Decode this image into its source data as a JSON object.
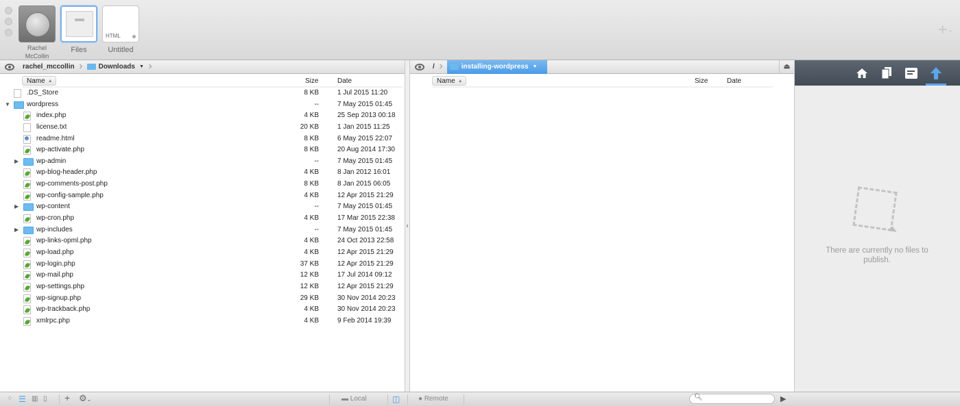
{
  "toolbar": {
    "sites": [
      {
        "label": "Rachel McCollin"
      },
      {
        "label": "Files"
      },
      {
        "label": "Untitled",
        "thumb_tag": "HTML"
      }
    ],
    "add_glyph": "+",
    "add_chevron": "⌄"
  },
  "local": {
    "crumbs": [
      "rachel_mccollin",
      "Downloads"
    ],
    "columns": {
      "name": "Name",
      "size": "Size",
      "date": "Date"
    },
    "files": [
      {
        "name": ".DS_Store",
        "size": "8 KB",
        "date": "1 Jul 2015 11:20",
        "type": "file",
        "level": 0
      },
      {
        "name": "wordpress",
        "size": "--",
        "date": "7 May 2015 01:45",
        "type": "folder",
        "level": 0,
        "expanded": true
      },
      {
        "name": "index.php",
        "size": "4 KB",
        "date": "25 Sep 2013 00:18",
        "type": "php",
        "level": 1
      },
      {
        "name": "license.txt",
        "size": "20 KB",
        "date": "1 Jan 2015 11:25",
        "type": "file",
        "level": 1
      },
      {
        "name": "readme.html",
        "size": "8 KB",
        "date": "6 May 2015 22:07",
        "type": "html",
        "level": 1
      },
      {
        "name": "wp-activate.php",
        "size": "8 KB",
        "date": "20 Aug 2014 17:30",
        "type": "php",
        "level": 1
      },
      {
        "name": "wp-admin",
        "size": "--",
        "date": "7 May 2015 01:45",
        "type": "folder",
        "level": 1,
        "expanded": false
      },
      {
        "name": "wp-blog-header.php",
        "size": "4 KB",
        "date": "8 Jan 2012 16:01",
        "type": "php",
        "level": 1
      },
      {
        "name": "wp-comments-post.php",
        "size": "8 KB",
        "date": "8 Jan 2015 06:05",
        "type": "php",
        "level": 1
      },
      {
        "name": "wp-config-sample.php",
        "size": "4 KB",
        "date": "12 Apr 2015 21:29",
        "type": "php",
        "level": 1
      },
      {
        "name": "wp-content",
        "size": "--",
        "date": "7 May 2015 01:45",
        "type": "folder",
        "level": 1,
        "expanded": false
      },
      {
        "name": "wp-cron.php",
        "size": "4 KB",
        "date": "17 Mar 2015 22:38",
        "type": "php",
        "level": 1
      },
      {
        "name": "wp-includes",
        "size": "--",
        "date": "7 May 2015 01:45",
        "type": "folder",
        "level": 1,
        "expanded": false
      },
      {
        "name": "wp-links-opml.php",
        "size": "4 KB",
        "date": "24 Oct 2013 22:58",
        "type": "php",
        "level": 1
      },
      {
        "name": "wp-load.php",
        "size": "4 KB",
        "date": "12 Apr 2015 21:29",
        "type": "php",
        "level": 1
      },
      {
        "name": "wp-login.php",
        "size": "37 KB",
        "date": "12 Apr 2015 21:29",
        "type": "php",
        "level": 1
      },
      {
        "name": "wp-mail.php",
        "size": "12 KB",
        "date": "17 Jul 2014 09:12",
        "type": "php",
        "level": 1
      },
      {
        "name": "wp-settings.php",
        "size": "12 KB",
        "date": "12 Apr 2015 21:29",
        "type": "php",
        "level": 1
      },
      {
        "name": "wp-signup.php",
        "size": "29 KB",
        "date": "30 Nov 2014 20:23",
        "type": "php",
        "level": 1
      },
      {
        "name": "wp-trackback.php",
        "size": "4 KB",
        "date": "30 Nov 2014 20:23",
        "type": "php",
        "level": 1
      },
      {
        "name": "xmlrpc.php",
        "size": "4 KB",
        "date": "9 Feb 2014 19:39",
        "type": "php",
        "level": 1
      }
    ]
  },
  "remote": {
    "crumbs": [
      "/",
      "installing-wordpress"
    ],
    "columns": {
      "name": "Name",
      "size": "Size",
      "date": "Date"
    }
  },
  "publish": {
    "empty_message": "There are currently no files to publish."
  },
  "bottombar": {
    "local_label": "Local",
    "remote_label": "Remote",
    "add_glyph": "+",
    "gear_glyph": "⚙"
  },
  "colors": {
    "accent": "#4b9be7",
    "folder": "#6cbcf2",
    "php_leaf": "#58a832",
    "publish_bar": "#4a535c"
  }
}
